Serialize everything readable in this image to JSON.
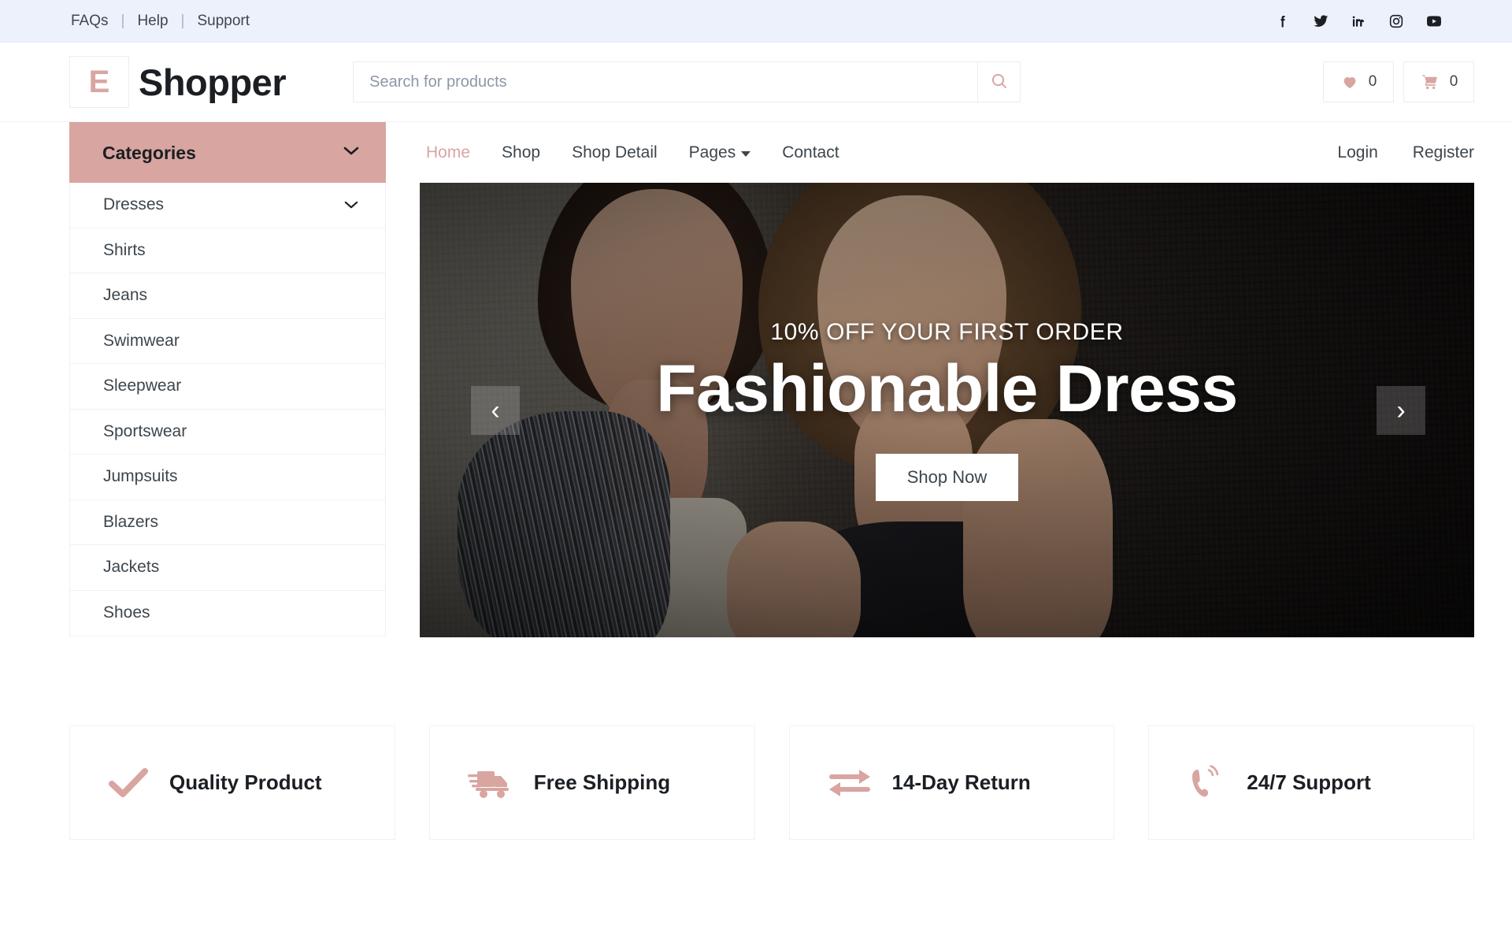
{
  "topbar": {
    "links": [
      "FAQs",
      "Help",
      "Support"
    ],
    "separator": "|",
    "social": [
      {
        "name": "facebook",
        "label": "Facebook"
      },
      {
        "name": "twitter",
        "label": "Twitter"
      },
      {
        "name": "linkedin",
        "label": "LinkedIn"
      },
      {
        "name": "instagram",
        "label": "Instagram"
      },
      {
        "name": "youtube",
        "label": "YouTube"
      }
    ]
  },
  "header": {
    "logo_badge": "E",
    "logo_text": "Shopper",
    "search_placeholder": "Search for products",
    "search_value": "",
    "search_icon": "search-icon",
    "wishlist_count": "0",
    "cart_count": "0"
  },
  "categories": {
    "title": "Categories",
    "items": [
      {
        "label": "Dresses",
        "has_chevron": true
      },
      {
        "label": "Shirts",
        "has_chevron": false
      },
      {
        "label": "Jeans",
        "has_chevron": false
      },
      {
        "label": "Swimwear",
        "has_chevron": false
      },
      {
        "label": "Sleepwear",
        "has_chevron": false
      },
      {
        "label": "Sportswear",
        "has_chevron": false
      },
      {
        "label": "Jumpsuits",
        "has_chevron": false
      },
      {
        "label": "Blazers",
        "has_chevron": false
      },
      {
        "label": "Jackets",
        "has_chevron": false
      },
      {
        "label": "Shoes",
        "has_chevron": false
      }
    ]
  },
  "nav": {
    "items": [
      {
        "label": "Home",
        "active": true,
        "dropdown": false
      },
      {
        "label": "Shop",
        "active": false,
        "dropdown": false
      },
      {
        "label": "Shop Detail",
        "active": false,
        "dropdown": false
      },
      {
        "label": "Pages",
        "active": false,
        "dropdown": true
      },
      {
        "label": "Contact",
        "active": false,
        "dropdown": false
      }
    ],
    "account": [
      {
        "label": "Login"
      },
      {
        "label": "Register"
      }
    ]
  },
  "hero": {
    "subtitle": "10% OFF YOUR FIRST ORDER",
    "title": "Fashionable Dress",
    "button": "Shop Now",
    "prev_label": "‹",
    "next_label": "›"
  },
  "features": [
    {
      "label": "Quality Product",
      "icon": "check-icon"
    },
    {
      "label": "Free Shipping",
      "icon": "shipping-truck-icon"
    },
    {
      "label": "14-Day Return",
      "icon": "exchange-arrows-icon"
    },
    {
      "label": "24/7 Support",
      "icon": "phone-ringing-icon"
    }
  ],
  "colors": {
    "accent": "#d9a5a0",
    "topbar_bg": "#edf1fb",
    "text": "#3d464d",
    "heading": "#1b1f23",
    "border": "#eef1f8"
  }
}
